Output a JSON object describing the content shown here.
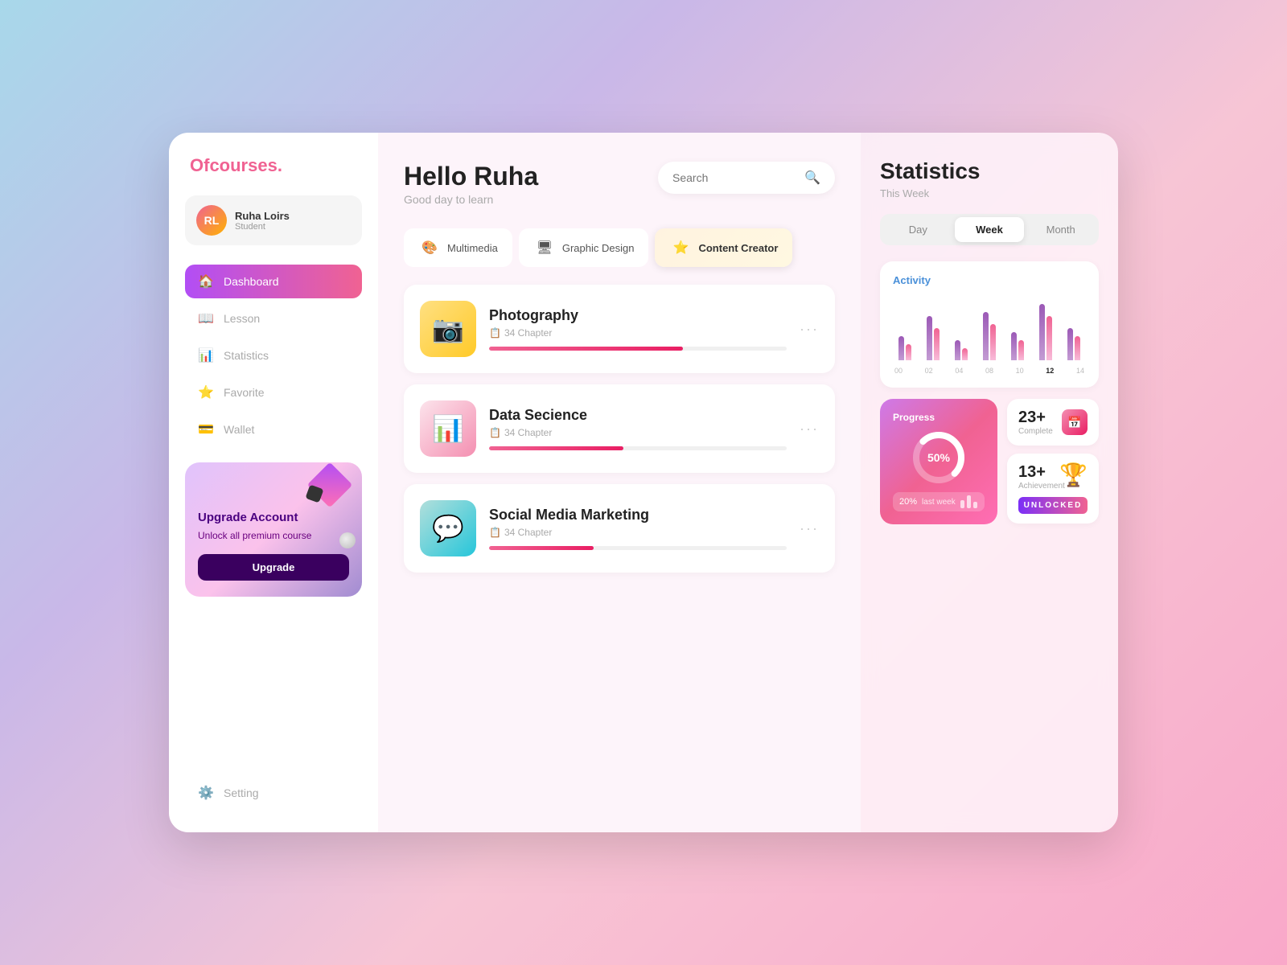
{
  "logo": {
    "text": "Ofcourses",
    "dot": "."
  },
  "user": {
    "name": "Ruha Loirs",
    "role": "Student",
    "initials": "RL"
  },
  "nav": {
    "items": [
      {
        "id": "dashboard",
        "label": "Dashboard",
        "icon": "🏠",
        "active": true
      },
      {
        "id": "lesson",
        "label": "Lesson",
        "icon": "📖",
        "active": false
      },
      {
        "id": "statistics",
        "label": "Statistics",
        "icon": "📊",
        "active": false
      },
      {
        "id": "favorite",
        "label": "Favorite",
        "icon": "⭐",
        "active": false
      },
      {
        "id": "wallet",
        "label": "Wallet",
        "icon": "💳",
        "active": false
      }
    ],
    "setting": "Setting"
  },
  "upgrade": {
    "title": "Upgrade Account",
    "description": "Unlock all premium course",
    "button": "Upgrade"
  },
  "main": {
    "greeting": "Hello Ruha",
    "subgreeting": "Good day to learn",
    "search": {
      "placeholder": "Search"
    },
    "tabs": [
      {
        "id": "multimedia",
        "label": "Multimedia",
        "icon": "🎨",
        "active": false
      },
      {
        "id": "graphic-design",
        "label": "Graphic Design",
        "icon": "🖥",
        "active": false
      },
      {
        "id": "content-creator",
        "label": "Content Creator",
        "icon": "⭐",
        "active": true
      }
    ],
    "courses": [
      {
        "id": "photography",
        "title": "Photography",
        "chapters": "34 Chapter",
        "progress": 65,
        "color": "yellow",
        "emoji": "📷"
      },
      {
        "id": "data-science",
        "title": "Data Secience",
        "chapters": "34 Chapter",
        "progress": 45,
        "color": "pink",
        "emoji": "📊"
      },
      {
        "id": "social-media",
        "title": "Social Media Marketing",
        "chapters": "34 Chapter",
        "progress": 35,
        "color": "teal",
        "emoji": "💬"
      }
    ]
  },
  "stats": {
    "title": "Statistics",
    "subtitle": "This Week",
    "periods": [
      "Day",
      "Week",
      "Month"
    ],
    "active_period": "Week",
    "activity": {
      "title": "Activity",
      "bars": [
        {
          "label": "00",
          "purple": 30,
          "pink": 20
        },
        {
          "label": "02",
          "purple": 55,
          "pink": 40
        },
        {
          "label": "04",
          "purple": 25,
          "pink": 15
        },
        {
          "label": "08",
          "purple": 60,
          "pink": 45
        },
        {
          "label": "10",
          "purple": 35,
          "pink": 25
        },
        {
          "label": "12",
          "purple": 70,
          "pink": 55
        },
        {
          "label": "14",
          "purple": 40,
          "pink": 30
        }
      ]
    },
    "progress": {
      "title": "Progress",
      "percent": "50%",
      "last_week_label": "20%",
      "last_week_text": "last week"
    },
    "complete": {
      "number": "23+",
      "label": "Complete"
    },
    "achievement": {
      "number": "13+",
      "label": "Achievement",
      "badge": "UNLOCKED"
    }
  }
}
